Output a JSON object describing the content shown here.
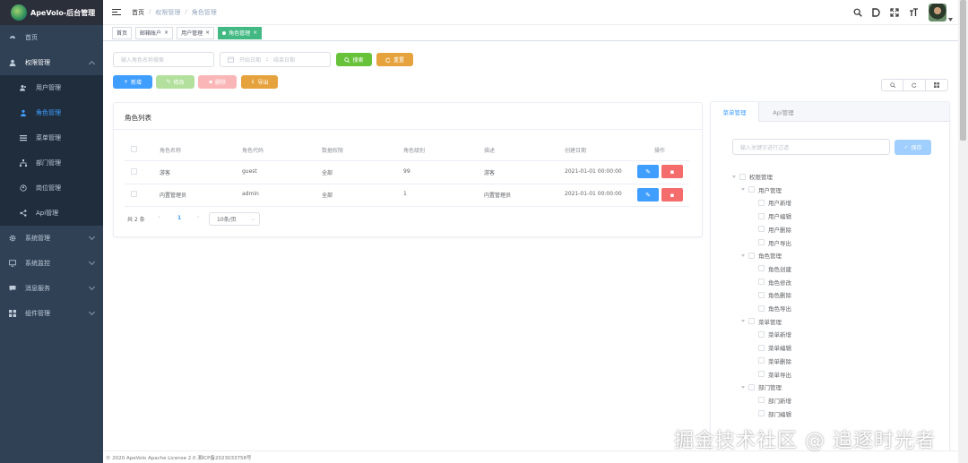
{
  "app": {
    "title": "ApeVolo-后台管理"
  },
  "sidebar": {
    "items": [
      {
        "label": "首页"
      },
      {
        "label": "权限管理"
      },
      {
        "label": "系统管理"
      },
      {
        "label": "系统监控"
      },
      {
        "label": "消息服务"
      },
      {
        "label": "组件管理"
      }
    ],
    "sub": [
      {
        "label": "用户管理"
      },
      {
        "label": "角色管理"
      },
      {
        "label": "菜单管理"
      },
      {
        "label": "部门管理"
      },
      {
        "label": "岗位管理"
      },
      {
        "label": "Api管理"
      }
    ]
  },
  "breadcrumb": {
    "home": "首页",
    "parent": "权限管理",
    "current": "角色管理"
  },
  "tags": [
    {
      "label": "首页"
    },
    {
      "label": "邮箱账户"
    },
    {
      "label": "用户管理"
    },
    {
      "label": "角色管理"
    }
  ],
  "search": {
    "name_placeholder": "输入角色名称搜索",
    "start_placeholder": "开始日期",
    "end_placeholder": "结束日期",
    "range_sep": ":",
    "search_label": "搜索",
    "reset_label": "重置"
  },
  "toolbar": {
    "add": "新增",
    "edit": "修改",
    "delete": "删除",
    "export": "导出"
  },
  "role_list": {
    "title": "角色列表",
    "headers": [
      "角色名称",
      "角色代码",
      "数据权限",
      "角色级别",
      "描述",
      "创建日期",
      "操作"
    ],
    "rows": [
      [
        "游客",
        "guest",
        "全部",
        "99",
        "游客",
        "2021-01-01 00:00:00"
      ],
      [
        "内置管理员",
        "admin",
        "全部",
        "1",
        "内置管理员",
        "2021-01-01 00:00:00"
      ]
    ]
  },
  "pagination": {
    "total": "共 2 条",
    "page": "1",
    "page_size": "10条/页"
  },
  "perm_panel": {
    "tabs": [
      "菜单管理",
      "Api管理"
    ],
    "filter_placeholder": "输入关键字进行过滤",
    "save": "保存",
    "tree": [
      {
        "label": "权限管理",
        "level": 0
      },
      {
        "label": "用户管理",
        "level": 1
      },
      {
        "label": "用户新增",
        "level": 2
      },
      {
        "label": "用户编辑",
        "level": 2
      },
      {
        "label": "用户删除",
        "level": 2
      },
      {
        "label": "用户导出",
        "level": 2
      },
      {
        "label": "角色管理",
        "level": 1
      },
      {
        "label": "角色创建",
        "level": 2
      },
      {
        "label": "角色修改",
        "level": 2
      },
      {
        "label": "角色删除",
        "level": 2
      },
      {
        "label": "角色导出",
        "level": 2
      },
      {
        "label": "菜单管理",
        "level": 1
      },
      {
        "label": "菜单新增",
        "level": 2
      },
      {
        "label": "菜单编辑",
        "level": 2
      },
      {
        "label": "菜单删除",
        "level": 2
      },
      {
        "label": "菜单导出",
        "level": 2
      },
      {
        "label": "部门管理",
        "level": 1
      },
      {
        "label": "部门新增",
        "level": 2
      },
      {
        "label": "部门编辑",
        "level": 2
      }
    ]
  },
  "footer": {
    "text": "© 2020 ApeVolo Apache License 2.0    湘ICP备2023033758号"
  },
  "watermark": "掘金技术社区 @ 追逐时光者",
  "colors": {
    "sidebar": "#304156",
    "primary": "#409eff",
    "success": "#67c23a",
    "warning": "#e6a23c",
    "danger": "#f56c6c",
    "tag_active": "#42b983"
  }
}
